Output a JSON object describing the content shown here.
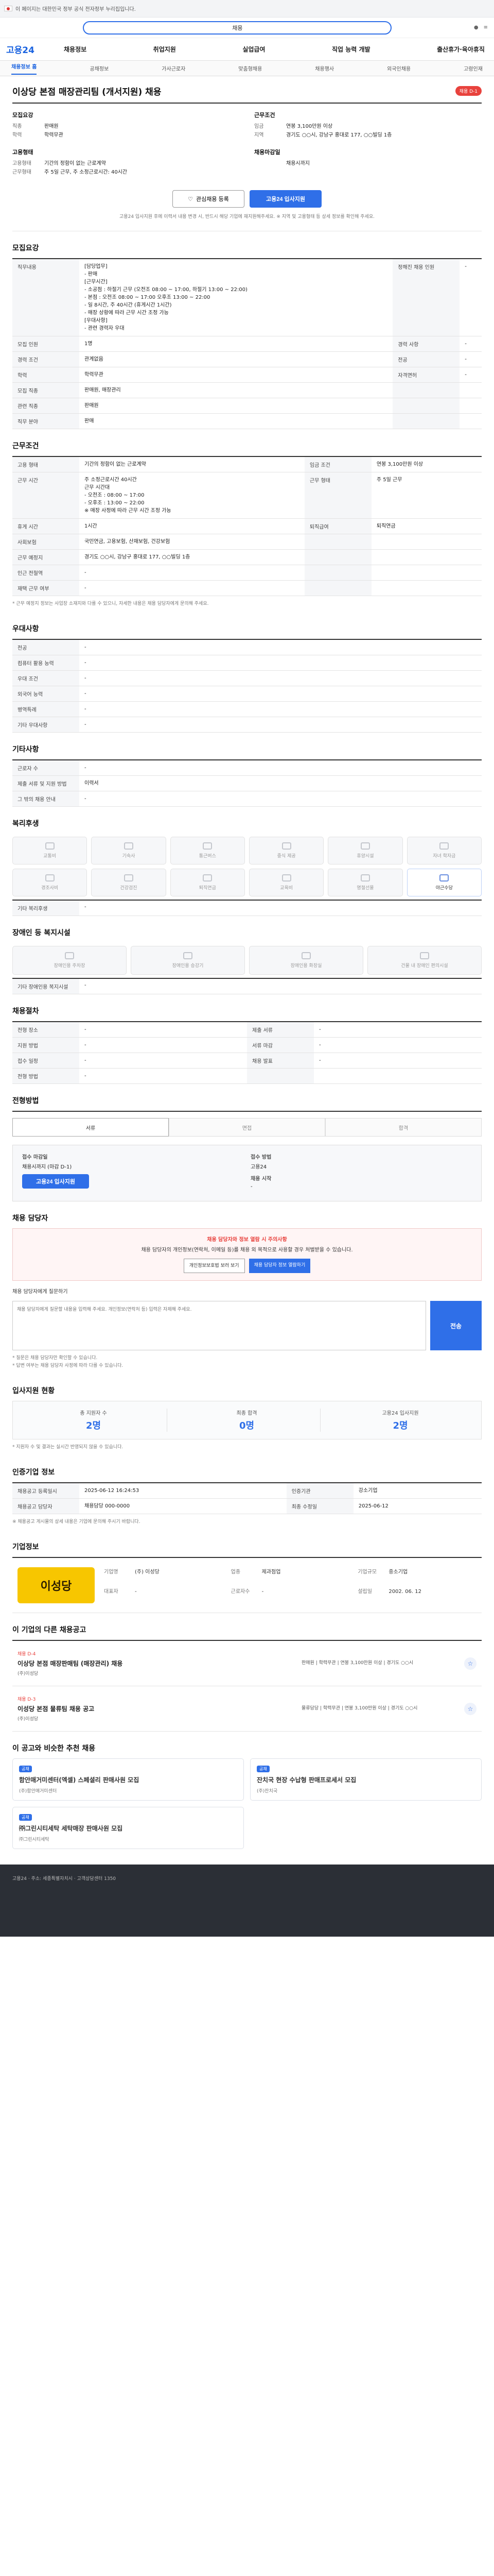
{
  "util": {
    "text": "이 페이지는 대한민국 정부 공식 전자정부 누리집입니다."
  },
  "search": {
    "text": "채용"
  },
  "gnb": {
    "logo": "고용24",
    "items": [
      "채용정보",
      "취업지원",
      "실업급여",
      "직업 능력 개발",
      "출산휴가·육아휴직"
    ]
  },
  "tabs": [
    "채용정보 홈",
    "공채정보",
    "가사근로자",
    "맞춤형채용",
    "채용행사",
    "외국인채용",
    "고령인재"
  ],
  "job": {
    "title": "이상당 본점 매장관리팀 (개서지원) 채용",
    "badge": "채용 D-1",
    "recruit_head": "모집요강",
    "recruit_rows": [
      {
        "k": "직종",
        "v": "판매원"
      },
      {
        "k": "학력",
        "v": "학력무관"
      }
    ],
    "cond_head": "근무조건",
    "cond_rows": [
      {
        "k": "임금",
        "v": "연봉 3,100만원 이상"
      },
      {
        "k": "지역",
        "v": "경기도 ○○시, 강남구 홍대로 177, ○○빌딩 1층"
      }
    ],
    "type_head": "고용형태",
    "type_rows": [
      {
        "k": "고용형태",
        "v": "기간의 정함이 없는 근로계약"
      },
      {
        "k": "근무형태",
        "v": "주 5일 근무, 주 소정근로시간: 40시간"
      }
    ],
    "deadline_head": "채용마감일",
    "deadline_rows": [
      {
        "k": "",
        "v": "채용시까지"
      }
    ],
    "buttons": {
      "scrap": "관심채용 등록",
      "apply": "고용24 입사지원"
    },
    "notice": "고용24 입사지원 후에 이력서 내용 변경 시, 반드시 해당 기업에 재지원해주세요. ※ 지역 및 고용형태 등 상세 정보를 확인해 주세요."
  },
  "sections": {
    "recruit": "모집요강",
    "conditions": "근무조건",
    "prefer": "우대사항",
    "other": "기타사항",
    "benefits": "복리후생",
    "care": "장애인 등 복지시설",
    "process": "채용절차",
    "apply": "전형방법",
    "contact": "채용 담당자",
    "stats": "입사지원 현황",
    "regist": "인증기업 정보",
    "company": "기업정보",
    "others": "이 기업의 다른 채용공고",
    "recommend": "이 공고와 비슷한 추천 채용"
  },
  "recruit_table": [
    {
      "k": "직무내용",
      "v": "[담당업무]\n- 판매\n[근무시간]\n- 소공점 : 하절기 근무 (오전조 08:00 ~ 17:00, 하절기 13:00 ~ 22:00)\n- 본점 : 오전조 08:00 ~ 17:00 오후조 13:00 ~ 22:00\n- 일 8시간, 주 40시간 (휴게시간 1시간)\n- 매장 상황에 따라 근무 시간 조정 가능\n[우대사항]\n- 관련 경력자 우대"
    },
    {
      "k": "모집 인원",
      "v": "1명"
    },
    {
      "k": "경력 조건",
      "v": "관계없음"
    },
    {
      "k": "학력",
      "v": "학력무관"
    },
    {
      "k": "모집 직종",
      "v": "판매원, 매장관리"
    },
    {
      "k": "관련 직종",
      "v": "판매원"
    },
    {
      "k": "직무 분야",
      "v": "판매"
    }
  ],
  "recruit_side": [
    {
      "k": "정해진 채용 인원",
      "v": "-"
    },
    {
      "k": "경력 사항",
      "v": "-"
    },
    {
      "k": "전공",
      "v": "-"
    },
    {
      "k": "자격면허",
      "v": "-"
    }
  ],
  "cond_table": [
    {
      "k": "고용 형태",
      "v": "기간의 정함이 없는 근로계약"
    },
    {
      "k": "근무 시간",
      "v": "주 소정근로시간 40시간\n근무 시간대\n- 오전조 : 08:00 ~ 17:00\n- 오후조 : 13:00 ~ 22:00\n※ 매장 사정에 따라 근무 시간 조정 가능"
    },
    {
      "k": "휴게 시간",
      "v": "1시간"
    },
    {
      "k": "사회보험",
      "v": "국민연금, 고용보험, 산재보험, 건강보험"
    },
    {
      "k": "근무 예정지",
      "v": "경기도 ○○시, 강남구 홍대로 177, ○○빌딩 1층"
    },
    {
      "k": "인근 전철역",
      "v": "-"
    },
    {
      "k": "재택 근무 여부",
      "v": "-"
    }
  ],
  "cond_side": [
    {
      "k": "임금 조건",
      "v": "연봉 3,100만원 이상"
    },
    {
      "k": "근무 형태",
      "v": "주 5일 근무"
    },
    {
      "k": "퇴직급여",
      "v": "퇴직연금"
    }
  ],
  "cond_note": "* 근무 예정지 정보는 사업장 소재지와 다를 수 있으니, 자세한 내용은 채용 담당자에게 문의해 주세요.",
  "map_link": "지도 보기",
  "prefer_table": [
    {
      "k": "전공",
      "v": "-"
    },
    {
      "k": "컴퓨터 활용 능력",
      "v": "-"
    },
    {
      "k": "우대 조건",
      "v": "-"
    },
    {
      "k": "외국어 능력",
      "v": "-"
    },
    {
      "k": "병역특례",
      "v": "-"
    },
    {
      "k": "기타 우대사항",
      "v": "-"
    }
  ],
  "other_table": [
    {
      "k": "근로자 수",
      "v": "-"
    },
    {
      "k": "제출 서류 및 지원 방법",
      "v": "이력서"
    },
    {
      "k": "그 밖의 채용 안내",
      "v": "-"
    }
  ],
  "benefits": [
    {
      "label": "교통비",
      "on": false
    },
    {
      "label": "기숙사",
      "on": false
    },
    {
      "label": "통근버스",
      "on": false
    },
    {
      "label": "중식 제공",
      "on": false
    },
    {
      "label": "휴양시설",
      "on": false
    },
    {
      "label": "자녀 학자금",
      "on": false
    },
    {
      "label": "경조사비",
      "on": false
    },
    {
      "label": "건강검진",
      "on": false
    },
    {
      "label": "퇴직연금",
      "on": false
    },
    {
      "label": "교육비",
      "on": false
    },
    {
      "label": "명절선물",
      "on": false
    },
    {
      "label": "야근수당",
      "on": true
    }
  ],
  "benefit_etc": "기타 복리후생",
  "benefit_etc_val": "-",
  "care": [
    {
      "label": "장애인용 주차장"
    },
    {
      "label": "장애인용 승강기"
    },
    {
      "label": "장애인용 화장실"
    },
    {
      "label": "건물 내 장애인 편의시설"
    }
  ],
  "care_etc": "기타 장애인용 복지시설",
  "care_etc_val": "-",
  "process_table": [
    {
      "k": "전형 장소",
      "v": "-"
    },
    {
      "k": "지원 방법",
      "v": "-"
    },
    {
      "k": "접수 일정",
      "v": "-"
    },
    {
      "k": "전형 방법",
      "v": "-"
    }
  ],
  "process_side": [
    {
      "k": "제출 서류",
      "v": "-"
    },
    {
      "k": "서류 마감",
      "v": "-"
    },
    {
      "k": "채용 발표",
      "v": "-"
    }
  ],
  "steps": [
    "서류",
    "면접",
    "합격"
  ],
  "apply_box": {
    "l1": "접수 마감일",
    "v1": "채용시까지 (마감 D-1)",
    "l2": "접수 방법",
    "v2": "고용24",
    "l3": "채용 시작",
    "v3": "-",
    "btn": "고용24 입사지원"
  },
  "contact_alert": {
    "title": "채용 담당자와 정보 열람 시 주의사항",
    "body": "채용 담당자의 개인정보(연락처, 이메일 등)를 채용 외 목적으로 사용할 경우 처벌받을 수 있습니다.",
    "btn1": "개인정보보호법 보러 보기",
    "btn2": "채용 담당자 정보 열람하기"
  },
  "inquiry": {
    "label": "채용 담당자에게 질문하기",
    "placeholder": "채용 담당자에게 질문할 내용을 입력해 주세요. 개인정보(연락처 등) 입력은 자제해 주세요.",
    "btn": "전송",
    "notes": [
      "* 질문은 채용 담당자만 확인할 수 있습니다.",
      "* 답변 여부는 채용 담당자 사정에 따라 다를 수 있습니다."
    ]
  },
  "stats": [
    {
      "l": "총 지원자 수",
      "n": "2명"
    },
    {
      "l": "최종 합격",
      "n": "0명"
    },
    {
      "l": "고용24 입사지원",
      "n": "2명"
    }
  ],
  "stats_note": "* 지원자 수 및 결과는 실시간 반영되지 않을 수 있습니다.",
  "regist_table": [
    {
      "k": "채용공고 등록일시",
      "v": "2025-06-12 16:24:53"
    },
    {
      "k": "채용공고 담당자",
      "v": "채용담당 000-0000"
    }
  ],
  "regist_side": [
    {
      "k": "인증기관",
      "v": "강소기업"
    },
    {
      "k": "최종 수정일",
      "v": "2025-06-12"
    }
  ],
  "regist_note": "※ 채용공고 게시물의 상세 내용은 기업에 문의해 주시기 바랍니다.",
  "company": {
    "logo_text": "이성당",
    "rows": [
      {
        "k": "기업명",
        "v": "(주) 이성당"
      },
      {
        "k": "업종",
        "v": "제과점업"
      },
      {
        "k": "기업규모",
        "v": "중소기업"
      },
      {
        "k": "대표자",
        "v": "-"
      },
      {
        "k": "근로자수",
        "v": "-"
      },
      {
        "k": "설립일",
        "v": "2002. 06. 12"
      }
    ]
  },
  "others": [
    {
      "tag": "채용 D-4",
      "title": "이상당 본점 매장판매팀 (매장관리) 채용",
      "sub": "(주)이성당",
      "meta": "판매원 | 학력무관 | 연봉 3,100만원 이상 | 경기도 ○○시"
    },
    {
      "tag": "채용 D-3",
      "title": "이성당 본점 물류팀 채용 공고",
      "sub": "(주)이성당",
      "meta": "물류담당 | 학력무관 | 연봉 3,100만원 이상 | 경기도 ○○시"
    }
  ],
  "recommend": [
    {
      "lbl": "공채",
      "title": "함안매거미센터(엑셀) 스페셜리 판매사원 모집",
      "sub": "(주)함안매거미센터"
    },
    {
      "lbl": "공채",
      "title": "잔치국 현장 수납형 판매프로세서 모집",
      "sub": "(주)잔치국"
    },
    {
      "lbl": "공채",
      "title": "㈜그린시티세탁 세탁매장 판매사원 모집",
      "sub": "㈜그린시티세탁"
    },
    {
      "lbl": "공채",
      "title": "",
      "sub": ""
    }
  ],
  "footer": "고용24 · 주소: 세종특별자치시 · 고객상담센터 1350"
}
